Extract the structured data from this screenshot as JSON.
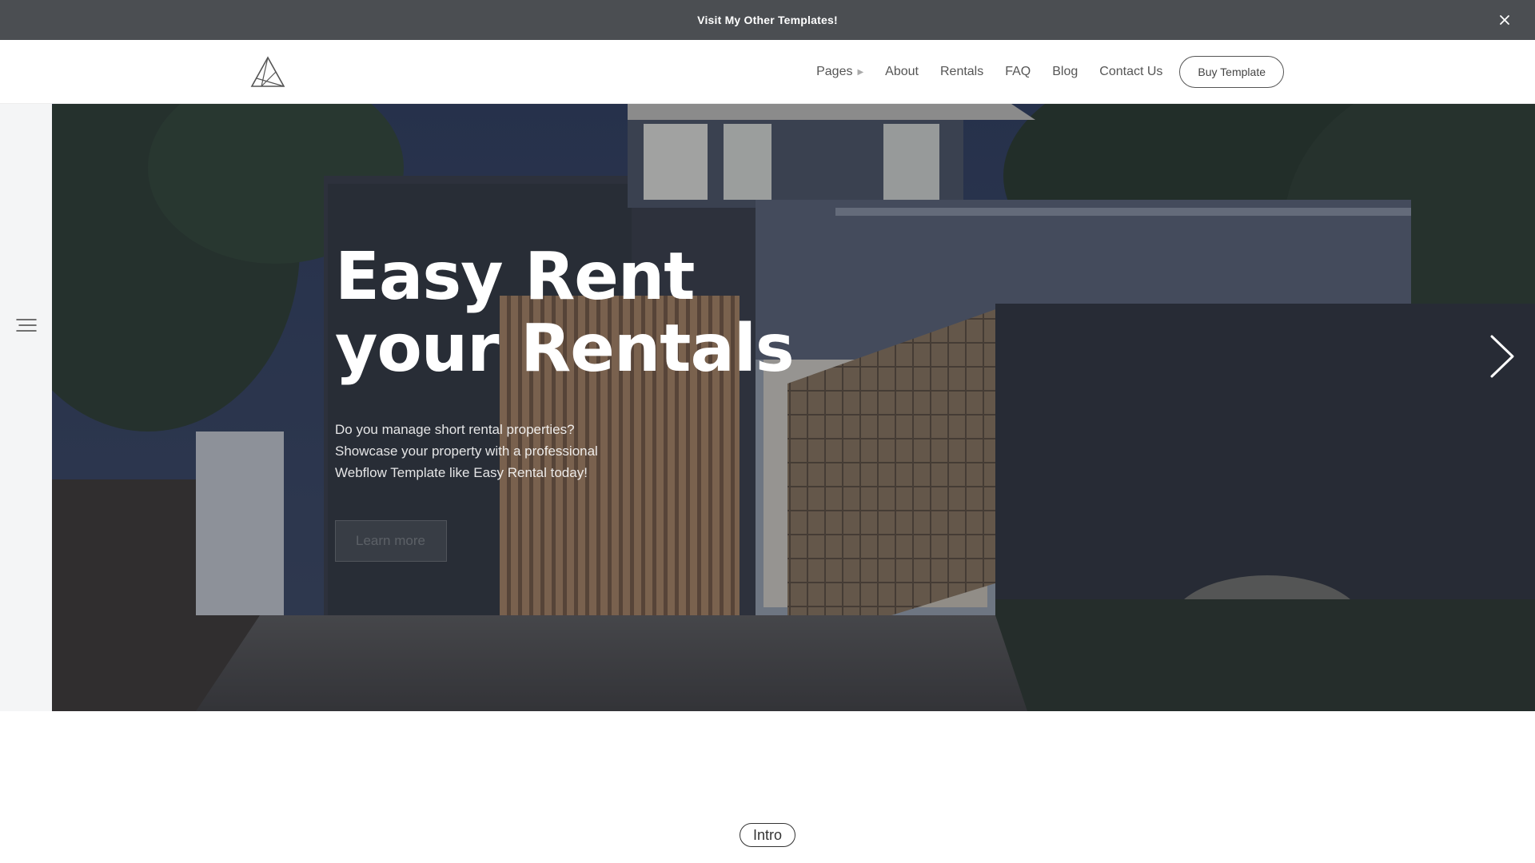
{
  "announcement": {
    "text": "Visit My Other Templates!",
    "close_icon": "close-icon"
  },
  "nav": {
    "logo_icon": "triangle-logo-icon",
    "items": [
      {
        "label": "Pages",
        "has_submenu": true
      },
      {
        "label": "About"
      },
      {
        "label": "Rentals"
      },
      {
        "label": "FAQ"
      },
      {
        "label": "Blog"
      },
      {
        "label": "Contact Us"
      }
    ],
    "cta_label": "Buy Template"
  },
  "hero": {
    "title_line1": "Easy Rent",
    "title_line2": "your Rentals",
    "subtitle": "Do you manage short rental properties? Showcase your property with a professional Webflow Template like Easy Rental today!",
    "button_label": "Learn more",
    "next_icon": "chevron-right-icon"
  },
  "side_rail": {
    "menu_icon": "hamburger-menu-icon"
  },
  "intro_label": "Intro",
  "colors": {
    "announcement_bg": "#4b4e52",
    "text_dark": "#333333",
    "hero_overlay": "#2e3340"
  }
}
